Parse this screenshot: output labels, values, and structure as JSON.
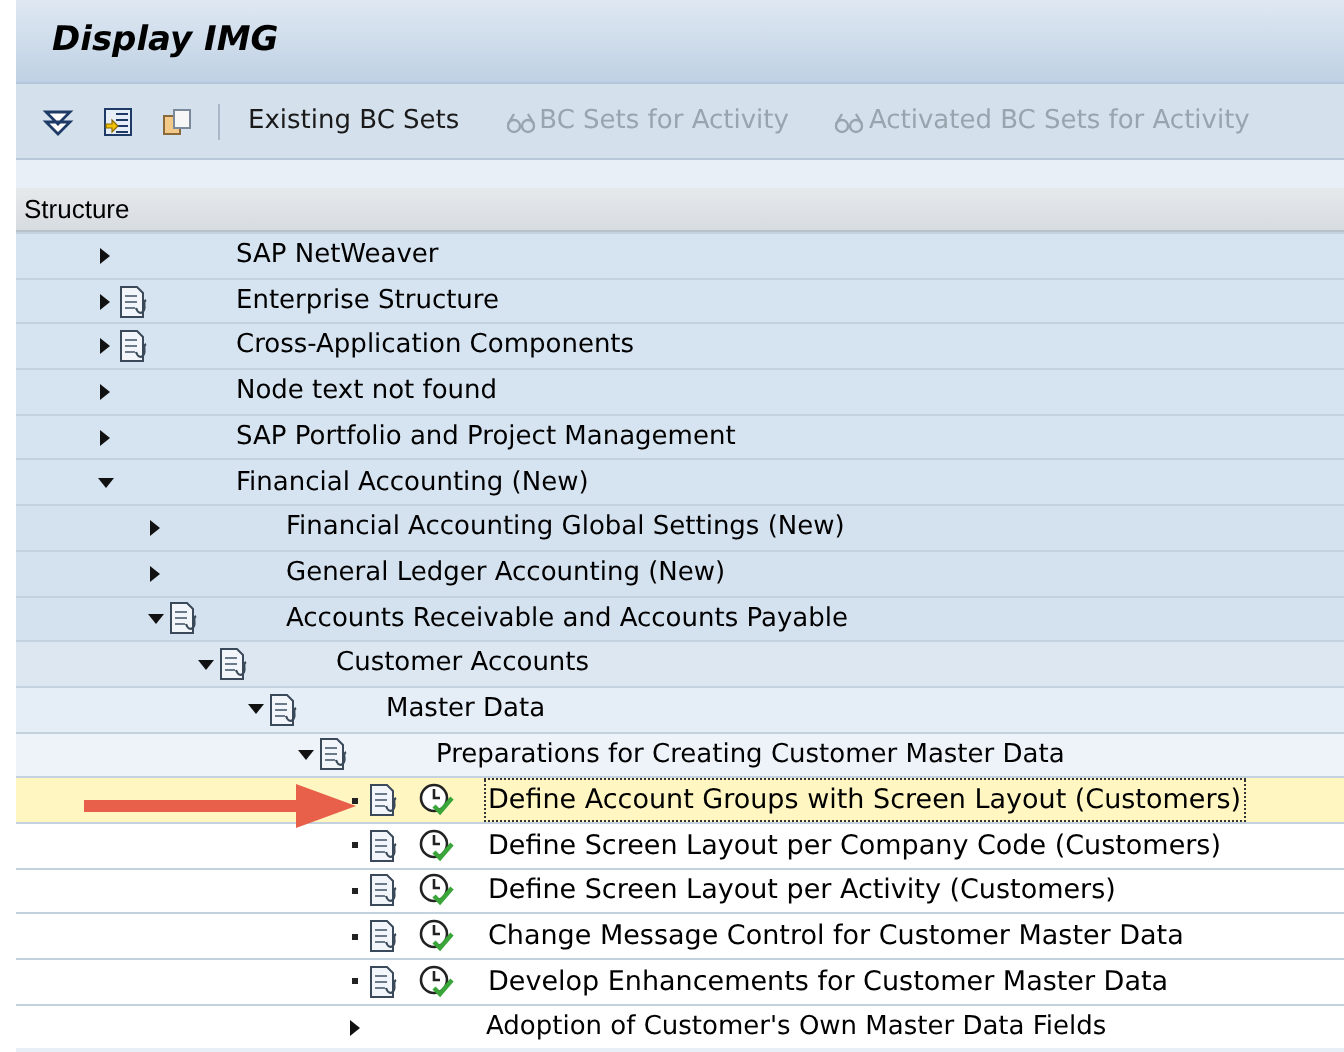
{
  "window": {
    "title": "Display IMG"
  },
  "toolbar": {
    "buttons": [
      {
        "label": "Existing BC Sets",
        "disabled": false,
        "has_icon": false
      },
      {
        "label": "BC Sets for Activity",
        "disabled": true,
        "has_icon": true
      },
      {
        "label": "Activated BC Sets for Activity",
        "disabled": true,
        "has_icon": true
      }
    ]
  },
  "tree": {
    "header": "Structure",
    "nodes": [
      {
        "label": "SAP NetWeaver",
        "kind": "folder",
        "expanded": false,
        "has_doc": false,
        "selected": false
      },
      {
        "label": "Enterprise Structure",
        "kind": "folder",
        "expanded": false,
        "has_doc": true,
        "selected": false
      },
      {
        "label": "Cross-Application Components",
        "kind": "folder",
        "expanded": false,
        "has_doc": true,
        "selected": false
      },
      {
        "label": "Node text not found",
        "kind": "folder",
        "expanded": false,
        "has_doc": false,
        "selected": false
      },
      {
        "label": "SAP Portfolio and Project Management",
        "kind": "folder",
        "expanded": false,
        "has_doc": false,
        "selected": false
      },
      {
        "label": "Financial Accounting (New)",
        "kind": "folder",
        "expanded": true,
        "has_doc": false,
        "selected": false,
        "children": [
          {
            "label": "Financial Accounting Global Settings (New)",
            "kind": "folder",
            "expanded": false,
            "has_doc": false,
            "selected": false
          },
          {
            "label": "General Ledger Accounting (New)",
            "kind": "folder",
            "expanded": false,
            "has_doc": false,
            "selected": false
          },
          {
            "label": "Accounts Receivable and Accounts Payable",
            "kind": "folder",
            "expanded": true,
            "has_doc": true,
            "selected": false,
            "children": [
              {
                "label": "Customer Accounts",
                "kind": "folder",
                "expanded": true,
                "has_doc": true,
                "selected": false,
                "children": [
                  {
                    "label": "Master Data",
                    "kind": "folder",
                    "expanded": true,
                    "has_doc": true,
                    "selected": false,
                    "children": [
                      {
                        "label": "Preparations for Creating Customer Master Data",
                        "kind": "folder",
                        "expanded": true,
                        "has_doc": true,
                        "selected": false,
                        "children": [
                          {
                            "label": "Define Account Groups with Screen Layout (Customers)",
                            "kind": "activity",
                            "has_doc": true,
                            "selected": true
                          },
                          {
                            "label": "Define Screen Layout per Company Code (Customers)",
                            "kind": "activity",
                            "has_doc": true,
                            "selected": false
                          },
                          {
                            "label": "Define Screen Layout per Activity (Customers)",
                            "kind": "activity",
                            "has_doc": true,
                            "selected": false
                          },
                          {
                            "label": "Change Message Control for Customer Master Data",
                            "kind": "activity",
                            "has_doc": true,
                            "selected": false
                          },
                          {
                            "label": "Develop Enhancements for Customer Master Data",
                            "kind": "activity",
                            "has_doc": true,
                            "selected": false
                          },
                          {
                            "label": "Adoption of Customer's Own Master Data Fields",
                            "kind": "folder",
                            "expanded": false,
                            "has_doc": false,
                            "selected": false
                          }
                        ]
                      }
                    ]
                  }
                ]
              }
            ]
          }
        ]
      }
    ]
  },
  "callout": {
    "kind": "arrow"
  }
}
